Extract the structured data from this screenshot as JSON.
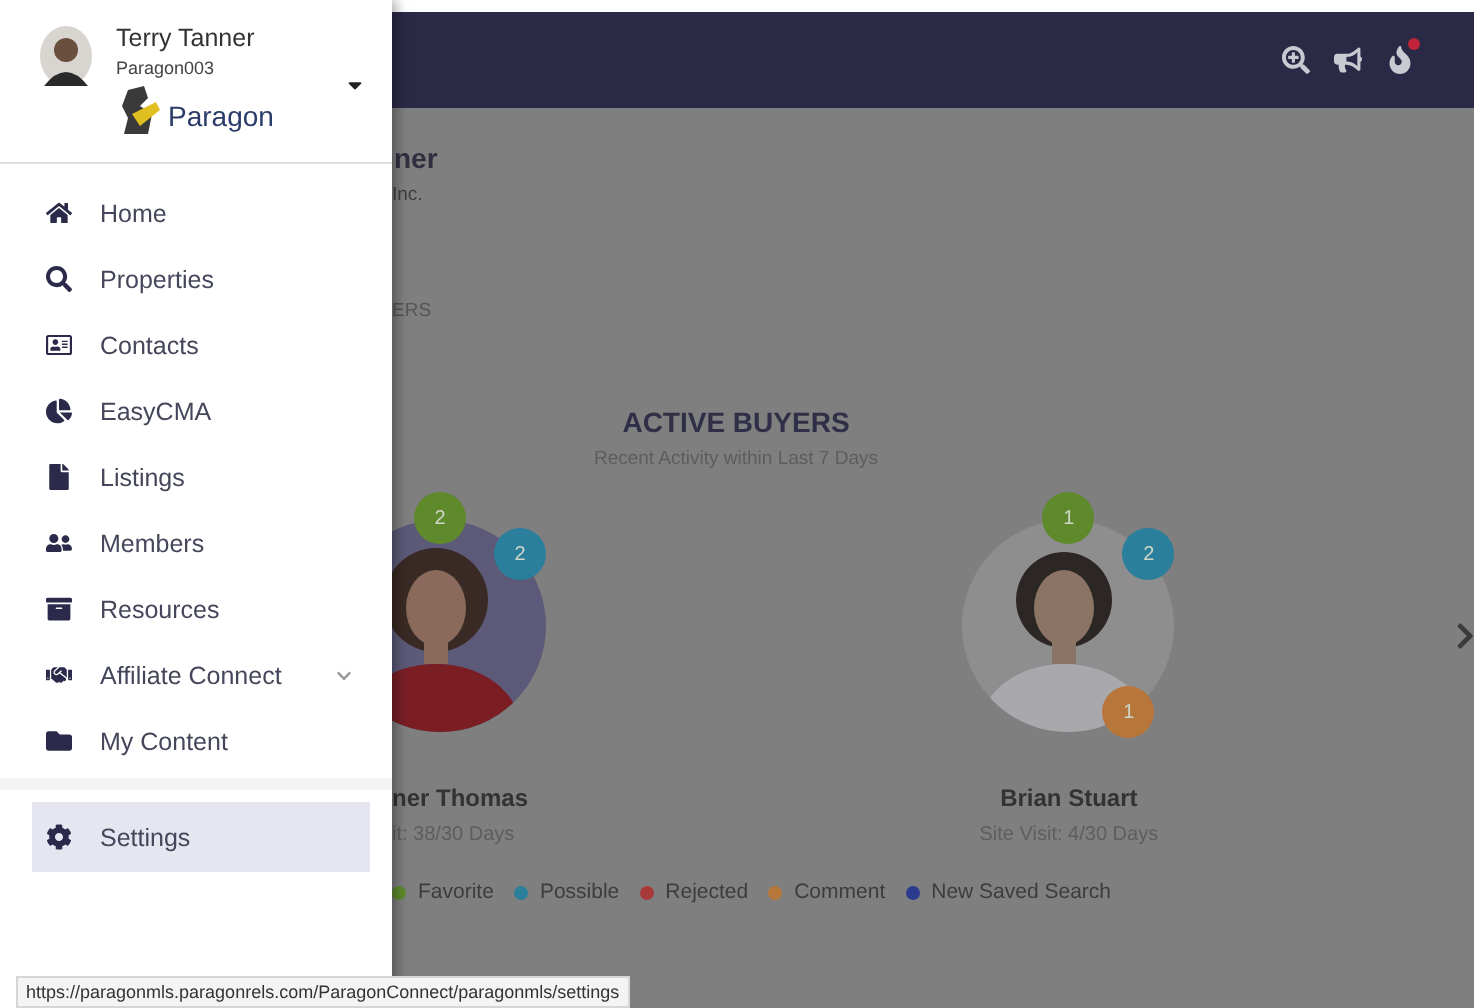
{
  "drawer": {
    "user": {
      "name": "Terry Tanner",
      "login": "Paragon003",
      "logo_text": "Paragon"
    },
    "menu": [
      {
        "label": "Home",
        "selected": false
      },
      {
        "label": "Properties",
        "selected": false
      },
      {
        "label": "Contacts",
        "selected": false
      },
      {
        "label": "EasyCMA",
        "selected": false
      },
      {
        "label": "Listings",
        "selected": false
      },
      {
        "label": "Members",
        "selected": false
      },
      {
        "label": "Resources",
        "selected": false
      },
      {
        "label": "Affiliate Connect",
        "selected": false,
        "expanded": false
      },
      {
        "label": "My Content",
        "selected": false
      }
    ],
    "footer_menu": [
      {
        "label": "Settings",
        "selected": true
      }
    ]
  },
  "page": {
    "agent_name": "ner",
    "agent_company": "Inc.",
    "section_label": "ERS",
    "active_buyers": {
      "title": "ACTIVE BUYERS",
      "subtitle": "Recent Activity within Last 7 Days",
      "buyers": [
        {
          "name": "ner Thomas",
          "visit": "it: 38/30 Days",
          "badges": [
            {
              "kind": "favorite",
              "count": "2",
              "color": "#5f8a2c"
            },
            {
              "kind": "possible",
              "count": "2",
              "color": "#2a7f9c"
            }
          ]
        },
        {
          "name": "Brian Stuart",
          "visit": "Site Visit: 4/30 Days",
          "badges": [
            {
              "kind": "favorite",
              "count": "1",
              "color": "#5f8a2c"
            },
            {
              "kind": "possible",
              "count": "2",
              "color": "#2a7f9c"
            },
            {
              "kind": "comment",
              "count": "1",
              "color": "#b8773a"
            }
          ]
        }
      ]
    },
    "legend": [
      {
        "label": "Favorite",
        "color": "#5f8a2c"
      },
      {
        "label": "Possible",
        "color": "#2a7f9c"
      },
      {
        "label": "Rejected",
        "color": "#a83a3a"
      },
      {
        "label": "Comment",
        "color": "#b8773a"
      },
      {
        "label": "New Saved Search",
        "color": "#2b3c8f"
      }
    ]
  },
  "status_url": "https://paragonmls.paragonrels.com/ParagonConnect/paragonmls/settings"
}
